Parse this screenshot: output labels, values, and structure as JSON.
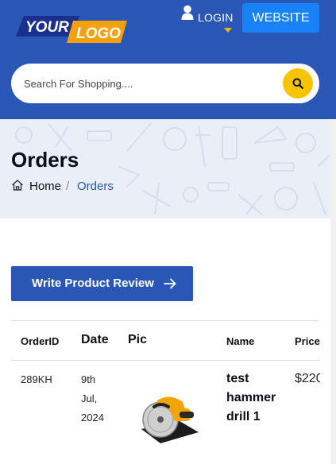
{
  "header": {
    "logo": {
      "word1": "YOUR",
      "word2": "LOGO"
    },
    "login_label": "LOGIN",
    "website_button": "WEBSITE",
    "search": {
      "placeholder": "Search For Shopping...."
    }
  },
  "banner": {
    "title": "Orders",
    "breadcrumb": {
      "home": "Home",
      "separator": "/",
      "current": "Orders"
    }
  },
  "review_button": {
    "label": "Write Product Review"
  },
  "table": {
    "headers": {
      "order_id": "OrderID",
      "date": "Date",
      "pic": "Pic",
      "name": "Name",
      "price": "Price"
    },
    "rows": [
      {
        "order_id": "289KH",
        "date_lines": [
          "9th",
          "Jul,",
          "2024"
        ],
        "name_lines": [
          "test",
          "hammer",
          "drill 1"
        ],
        "price": "$220"
      }
    ]
  },
  "colors": {
    "header_blue": "#2a57b5",
    "accent_yellow": "#f8c400",
    "website_button": "#1a82f7",
    "banner_bg": "#e9eef7",
    "logo_orange": "#f5a00f"
  }
}
